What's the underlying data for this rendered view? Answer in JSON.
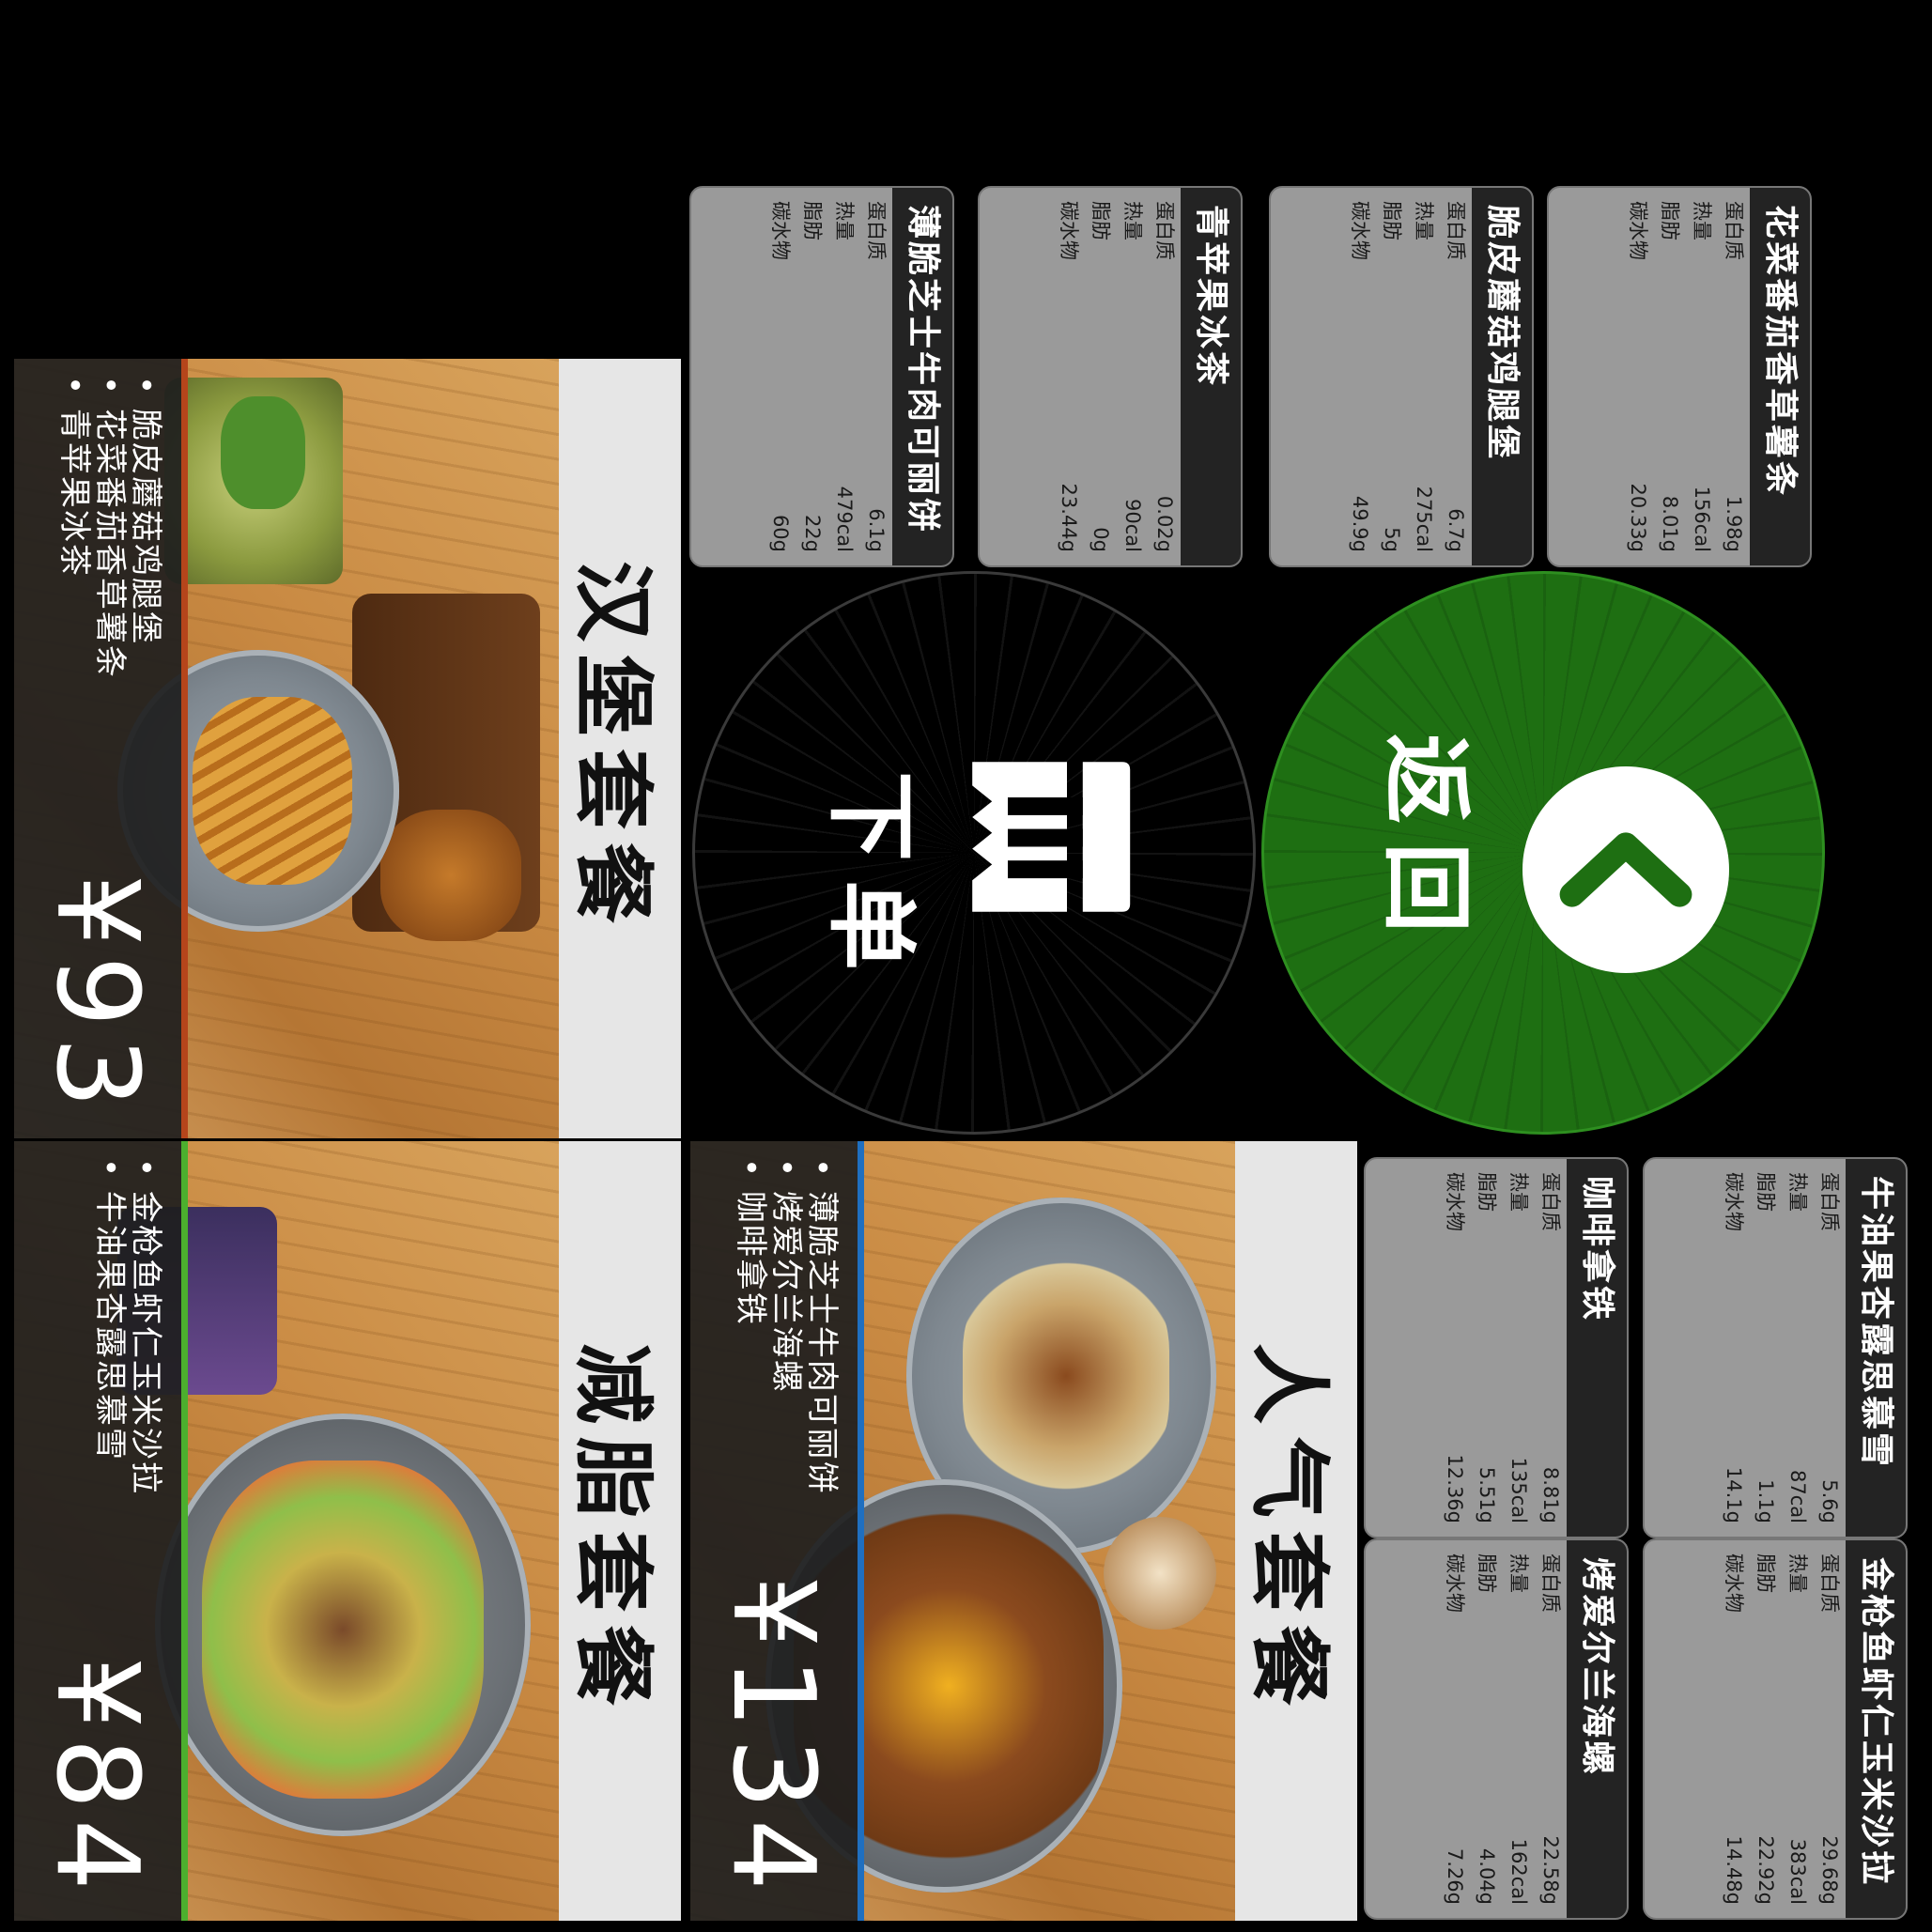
{
  "combos": {
    "hamburger": {
      "title": "汉堡套餐",
      "items": [
        "脆皮蘑菇鸡腿堡",
        "花菜番茄香草薯条",
        "青苹果冰茶"
      ],
      "price": "¥93",
      "accent_color": "#b5451b"
    },
    "fat_loss": {
      "title": "减脂套餐",
      "items": [
        "金枪鱼虾仁玉米沙拉",
        "牛油果杏露思慕雪"
      ],
      "price": "¥84",
      "accent_color": "#4caf2e"
    },
    "popular": {
      "title": "人气套餐",
      "items": [
        "薄脆芝士牛肉可丽饼",
        "烤爱尔兰海螺",
        "咖啡拿铁"
      ],
      "price": "¥134",
      "accent_color": "#1f6fc0"
    }
  },
  "labels": {
    "protein": "蛋白质",
    "calories": "热量",
    "fat": "脂肪",
    "carbs": "碳水物"
  },
  "nutrition": {
    "crepe": {
      "name": "薄脆芝士牛肉可丽饼",
      "protein": "6.1g",
      "calories": "479cal",
      "fat": "22g",
      "carbs": "60g"
    },
    "apple_tea": {
      "name": "青苹果冰茶",
      "protein": "0.02g",
      "calories": "90cal",
      "fat": "0g",
      "carbs": "23.44g"
    },
    "chicken_burger": {
      "name": "脆皮蘑菇鸡腿堡",
      "protein": "6.7g",
      "calories": "275cal",
      "fat": "5g",
      "carbs": "49.9g"
    },
    "fries": {
      "name": "花菜番茄香草薯条",
      "protein": "1.98g",
      "calories": "156cal",
      "fat": "8.01g",
      "carbs": "20.33g"
    },
    "latte": {
      "name": "咖啡拿铁",
      "protein": "8.81g",
      "calories": "135cal",
      "fat": "5.51g",
      "carbs": "12.36g"
    },
    "smoothie": {
      "name": "牛油果杏露思慕雪",
      "protein": "5.6g",
      "calories": "87cal",
      "fat": "1.1g",
      "carbs": "14.1g"
    },
    "whelk": {
      "name": "烤爱尔兰海螺",
      "protein": "22.58g",
      "calories": "162cal",
      "fat": "4.04g",
      "carbs": "7.26g"
    },
    "salad": {
      "name": "金枪鱼虾仁玉米沙拉",
      "protein": "29.68g",
      "calories": "383cal",
      "fat": "22.92g",
      "carbs": "14.48g"
    }
  },
  "buttons": {
    "order": {
      "label": "下单",
      "icon": "receipt-icon",
      "color": "#000000"
    },
    "back": {
      "label": "返回",
      "icon": "chevron-left-icon",
      "color": "#1e6f12"
    }
  }
}
